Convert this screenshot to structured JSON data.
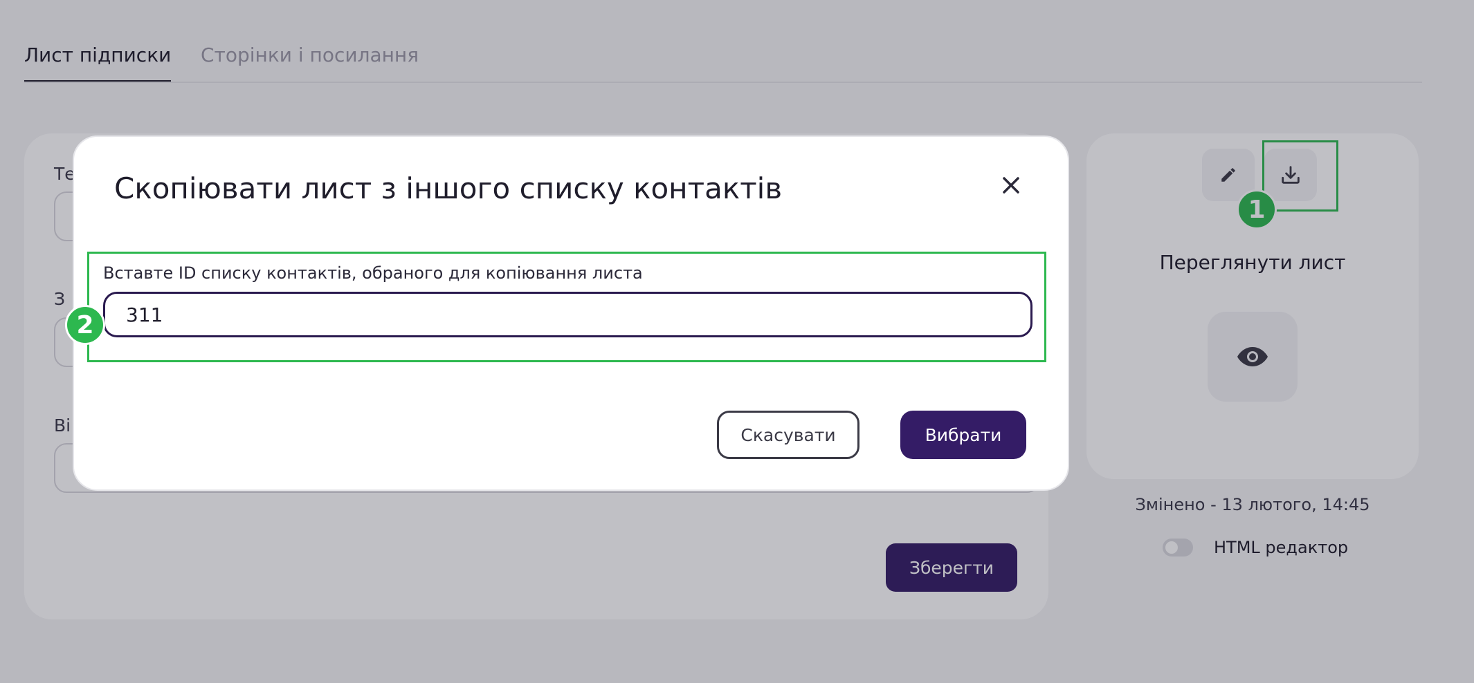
{
  "tabs": [
    {
      "label": "Лист підписки",
      "active": true
    },
    {
      "label": "Сторінки і посилання",
      "active": false
    }
  ],
  "form": {
    "labels": [
      "Те",
      "З",
      "Ві"
    ],
    "save_label": "Зберегти"
  },
  "preview": {
    "title": "Переглянути лист",
    "modified": "Змінено - 13 лютого, 14:45",
    "html_editor_label": "HTML редактор",
    "html_editor_enabled": false
  },
  "modal": {
    "title": "Скопіювати лист з іншого списку контактів",
    "field_label": "Вставте ID списку контактів, обраного для копіювання листа",
    "field_value": "311",
    "cancel_label": "Скасувати",
    "select_label": "Вибрати"
  },
  "annotations": {
    "step1": "1",
    "step2": "2",
    "color": "#2db84f"
  },
  "colors": {
    "primary": "#341c66",
    "text": "#1f1d2b",
    "highlight": "#2db84f"
  }
}
